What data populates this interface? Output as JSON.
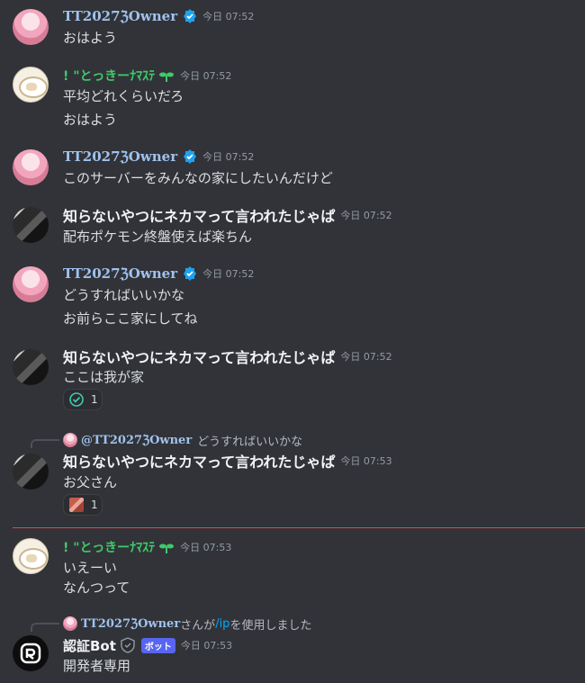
{
  "messages": [
    {
      "user": "TT2027ℨOwner",
      "time": "今日 07:52",
      "lines": [
        "おはよう"
      ]
    },
    {
      "user": "! \"とっきーﾅﾏｽﾃ",
      "time": "今日 07:52",
      "lines": [
        "平均どれくらいだろ",
        "おはよう"
      ]
    },
    {
      "user": "TT2027ℨOwner",
      "time": "今日 07:52",
      "lines": [
        "このサーバーをみんなの家にしたいんだけど"
      ]
    },
    {
      "user": "知らないやつにネカマって言われたじゃぱ",
      "time": "今日 07:52",
      "lines": [
        "配布ポケモン終盤使えば楽ちん"
      ]
    },
    {
      "user": "TT2027ℨOwner",
      "time": "今日 07:52",
      "lines": [
        "どうすればいいかな",
        "お前らここ家にしてね"
      ]
    },
    {
      "user": "知らないやつにネカマって言われたじゃぱ",
      "time": "今日 07:52",
      "lines": [
        "ここは我が家"
      ],
      "reaction": {
        "emoji": "check-emoji",
        "count": "1"
      }
    },
    {
      "reply_to": {
        "name": "@TT2027ℨOwner",
        "text": "どうすればいいかな"
      },
      "user": "知らないやつにネカマって言われたじゃぱ",
      "time": "今日 07:53",
      "lines": [
        "お父さん"
      ],
      "reaction": {
        "emoji": "image-emoji",
        "count": "1"
      }
    },
    {
      "user": "! \"とっきーﾅﾏｽﾃ",
      "time": "今日 07:53",
      "lines": [
        "いえーい",
        "なんつって"
      ]
    },
    {
      "reply_to": {
        "name": "TT2027ℨOwner",
        "text_prefix": "さんが",
        "command": "/ip",
        "text_suffix": "を使用しました"
      },
      "user": "認証Bot",
      "tag": "ボット",
      "time": "今日 07:53",
      "lines": [
        "開発者専用"
      ]
    }
  ],
  "colors": {
    "background": "#313338",
    "owner_name": "#a0c2ee",
    "green_name": "#3ecb6a",
    "new_divider": "#f23f43",
    "bot_tag": "#5865f2"
  }
}
